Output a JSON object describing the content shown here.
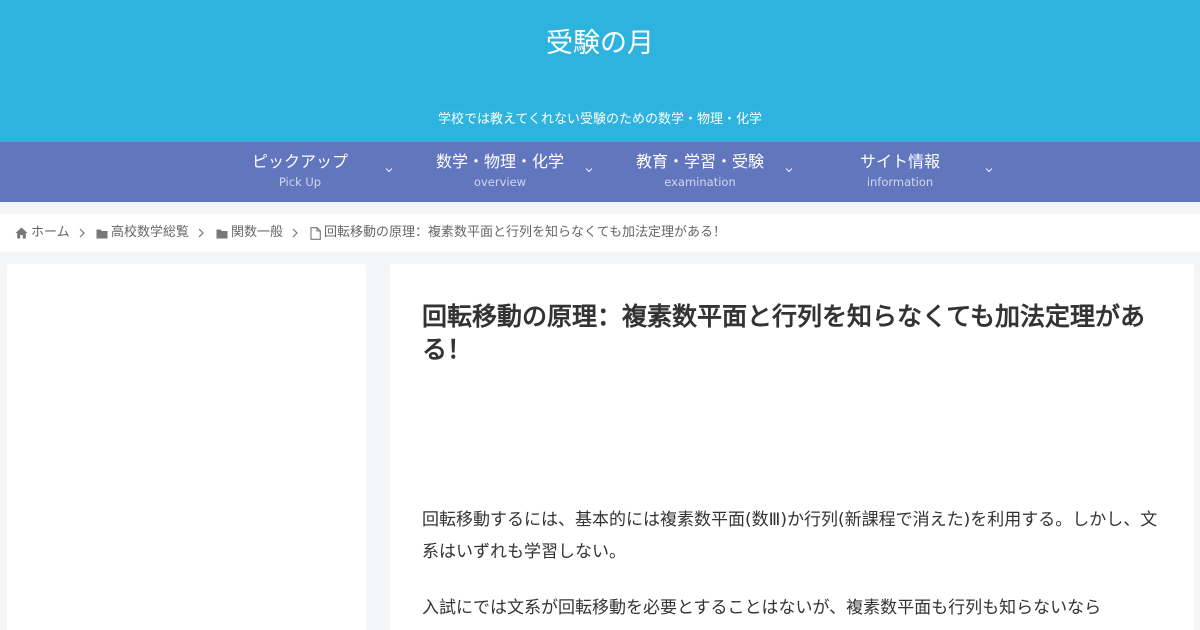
{
  "site": {
    "title": "受験の月",
    "description": "学校では教えてくれない受験のための数学・物理・化学"
  },
  "nav": [
    {
      "label": "ピックアップ",
      "sub": "Pick Up"
    },
    {
      "label": "数学・物理・化学",
      "sub": "overview"
    },
    {
      "label": "教育・学習・受験",
      "sub": "examination"
    },
    {
      "label": "サイト情報",
      "sub": "information"
    }
  ],
  "breadcrumb": {
    "home": "ホーム",
    "category": "高校数学総覧",
    "subcategory": "関数一般",
    "current": "回転移動の原理：複素数平面と行列を知らなくても加法定理がある！"
  },
  "article": {
    "title": "回転移動の原理：複素数平面と行列を知らなくても加法定理がある！",
    "paragraphs": [
      "回転移動するには、基本的には複素数平面(数Ⅲ)か行列(新課程で消えた)を利用する。しかし、文系はいずれも学習しない。",
      "入試にでは文系が回転移動を必要とすることはないが、複素数平面も行列も知らないなら"
    ]
  },
  "colors": {
    "header_bg": "#2db3de",
    "nav_bg": "#6276be",
    "page_bg": "#f3f5f7"
  },
  "icons": {
    "home": "home-icon",
    "folder": "folder-icon",
    "file": "file-icon",
    "chevron_right": "chevron-right-icon",
    "chevron_down": "chevron-down-icon"
  }
}
